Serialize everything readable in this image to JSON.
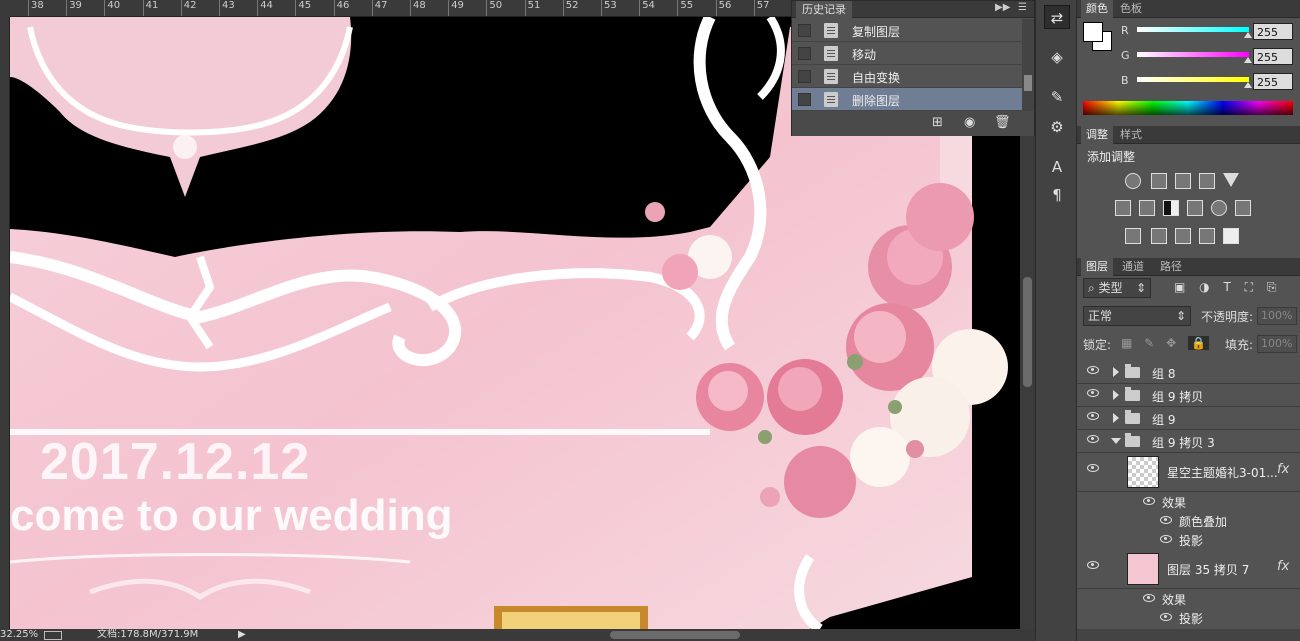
{
  "ruler": {
    "ticks": [
      "38",
      "39",
      "40",
      "41",
      "42",
      "43",
      "44",
      "45",
      "46",
      "47",
      "48",
      "49",
      "50",
      "51",
      "52",
      "53",
      "54",
      "55",
      "56",
      "57"
    ]
  },
  "canvas": {
    "date_text": "2017.12.12",
    "welcome_text": "come to our wedding"
  },
  "status": {
    "zoom": "32.25%",
    "doc_info": "文档:178.8M/371.9M"
  },
  "history": {
    "tab_label": "历史记录",
    "items": [
      {
        "label": "复制图层",
        "selected": false
      },
      {
        "label": "移动",
        "selected": false
      },
      {
        "label": "自由变换",
        "selected": false
      },
      {
        "label": "删除图层",
        "selected": true
      }
    ]
  },
  "color_panel": {
    "tabs": [
      "颜色",
      "色板"
    ],
    "channels": [
      {
        "label": "R",
        "value": "255",
        "color": "#00ffff"
      },
      {
        "label": "G",
        "value": "255",
        "color": "#ff00ff"
      },
      {
        "label": "B",
        "value": "255",
        "color": "#ffff00"
      }
    ]
  },
  "adjust_panel": {
    "tabs": [
      "调整",
      "样式"
    ],
    "title": "添加调整"
  },
  "layers_panel": {
    "tabs": [
      "图层",
      "通道",
      "路径"
    ],
    "filter_kind": "类型",
    "blend_mode": "正常",
    "opacity_label": "不透明度:",
    "opacity_value": "100%",
    "lock_label": "锁定:",
    "fill_label": "填充:",
    "fill_value": "100%",
    "groups": [
      {
        "name": "组 8",
        "open": false
      },
      {
        "name": "组 9 拷贝",
        "open": false
      },
      {
        "name": "组 9",
        "open": false
      },
      {
        "name": "组 9 拷贝 3",
        "open": true
      }
    ],
    "layer1": {
      "name": "星空主题婚礼3-01...",
      "fx": "fx",
      "effects_label": "效果",
      "effects": [
        "颜色叠加",
        "投影"
      ]
    },
    "layer2": {
      "name": "图层 35 拷贝 7",
      "fx": "fx",
      "effects_label": "效果",
      "effects": [
        "投影"
      ]
    }
  }
}
